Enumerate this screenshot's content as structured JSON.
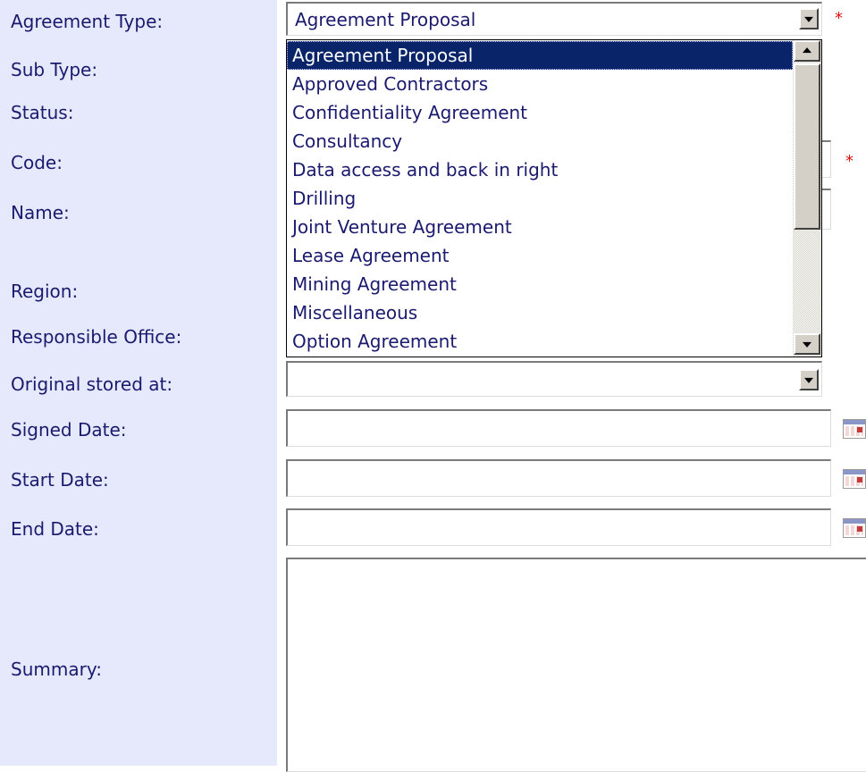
{
  "labels": {
    "agreement_type": "Agreement Type:",
    "sub_type": "Sub Type:",
    "status": "Status:",
    "code": "Code:",
    "name": "Name:",
    "region": "Region:",
    "responsible_office": "Responsible Office:",
    "original_stored_at": "Original stored at:",
    "signed_date": "Signed Date:",
    "start_date": "Start Date:",
    "end_date": "End Date:",
    "summary": "Summary:"
  },
  "agreement_type": {
    "value": "Agreement Proposal",
    "required_marker": "*",
    "options": [
      "Agreement Proposal",
      "Approved Contractors",
      "Confidentiality Agreement",
      "Consultancy",
      "Data access and back in right",
      "Drilling",
      "Joint Venture Agreement",
      "Lease Agreement",
      "Mining Agreement",
      "Miscellaneous",
      "Option Agreement"
    ],
    "selected_option": "Agreement Proposal"
  },
  "code": {
    "required_marker": "*",
    "value": ""
  },
  "name": {
    "value": ""
  },
  "original_stored_at": {
    "value": ""
  },
  "signed_date": {
    "value": "",
    "icon": "calendar-icon"
  },
  "start_date": {
    "value": "",
    "icon": "calendar-icon"
  },
  "end_date": {
    "value": "",
    "icon": "calendar-icon"
  },
  "summary": {
    "value": ""
  },
  "colors": {
    "label_background": "#e6e8fb",
    "label_text": "#1a1a6e",
    "selection_background": "#0a246a",
    "required_marker": "#e01010"
  }
}
